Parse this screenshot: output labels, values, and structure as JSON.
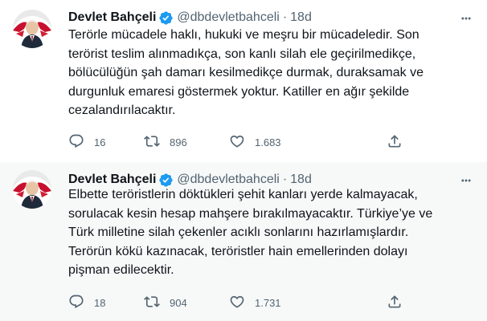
{
  "tweets": [
    {
      "name": "Devlet Bahçeli",
      "handle": "@dbdevletbahceli",
      "separator": "·",
      "time": "18d",
      "text": "Terörle mücadele haklı, hukuki ve meşru bir mücadeledir. Son\nterörist teslim alınmadıkça, son kanlı silah ele geçirilmedikçe,\nbölücülüğün şah damarı kesilmedikçe durmak, duraksamak ve\ndurgunluk emaresi göstermek yoktur. Katiller en ağır şekilde\ncezalandırılacaktır.",
      "replies": "16",
      "retweets": "896",
      "likes": "1.683"
    },
    {
      "name": "Devlet Bahçeli",
      "handle": "@dbdevletbahceli",
      "separator": "·",
      "time": "18d",
      "text": "Elbette teröristlerin döktükleri şehit kanları yerde kalmayacak,\nsorulacak kesin hesap mahşere bırakılmayacaktır. Türkiye’ye ve\nTürk milletine silah çekenler acıklı sonlarını hazırlamışlardır.\nTerörün kökü kazınacak, teröristler hain emellerinden dolayı\npişman edilecektir.",
      "replies": "18",
      "retweets": "904",
      "likes": "1.731"
    }
  ],
  "icons": {
    "verified": "verified-badge-icon",
    "more": "more-options-icon",
    "reply": "reply-icon",
    "retweet": "retweet-icon",
    "like": "heart-icon",
    "share": "share-icon"
  },
  "colors": {
    "text": "#0f1419",
    "muted": "#536471",
    "verified": "#1d9bf0",
    "avatar_red": "#c8102e",
    "hover_background": "#f7f9f9"
  }
}
